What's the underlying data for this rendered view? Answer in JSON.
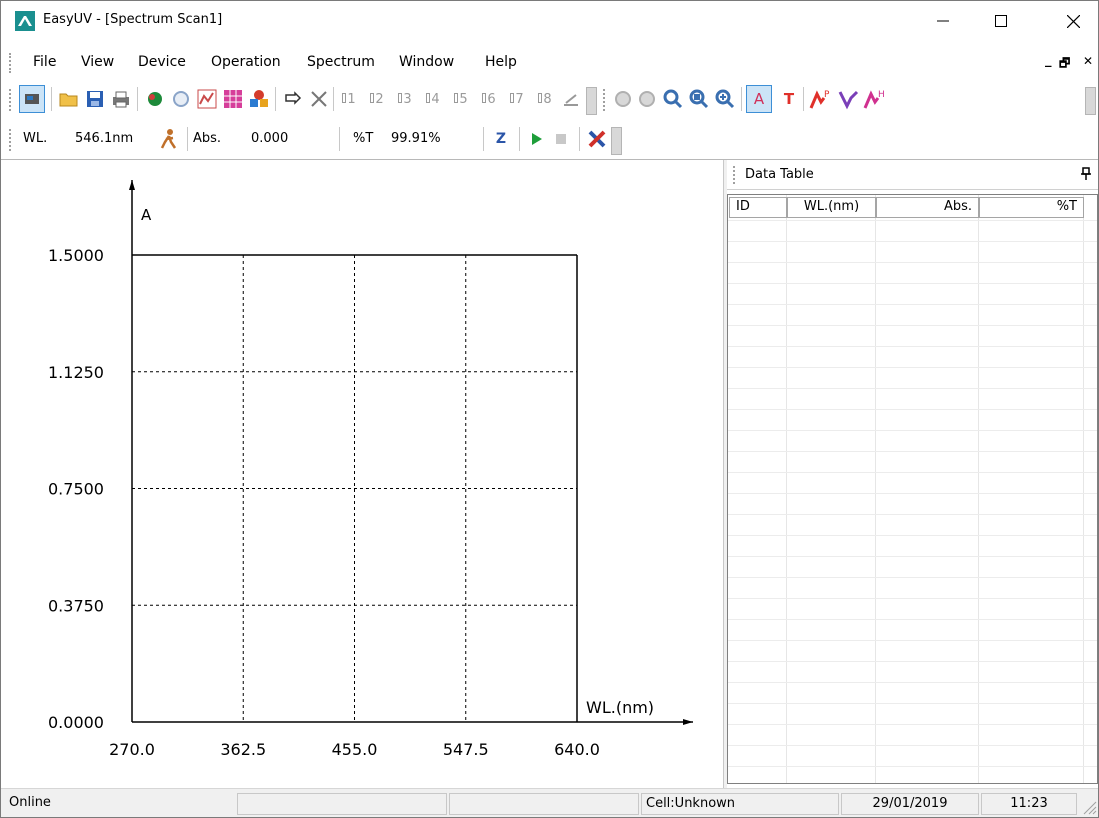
{
  "window": {
    "title": "EasyUV - [Spectrum Scan1]",
    "minimize_glyph": "—",
    "maximize_glyph": "☐",
    "close_glyph": "✕"
  },
  "menu": {
    "items": [
      {
        "label": "File"
      },
      {
        "label": "View"
      },
      {
        "label": "Device"
      },
      {
        "label": "Operation"
      },
      {
        "label": "Spectrum"
      },
      {
        "label": "Window"
      },
      {
        "label": "Help"
      }
    ],
    "mdi_minimize": "_",
    "mdi_restore": "🗗",
    "mdi_close": "✕"
  },
  "toolbar1": {
    "cell_labels": [
      "1",
      "2",
      "3",
      "4",
      "5",
      "6",
      "7",
      "8"
    ]
  },
  "toolbar2": {
    "wl_label": "WL.",
    "wl_value": "546.1nm",
    "abs_label": "Abs.",
    "abs_value": "0.000",
    "t_label": "%T",
    "t_value": "99.91%",
    "zero_label": "Z"
  },
  "chart_data": {
    "type": "line",
    "title": "",
    "xlabel": "WL.(nm)",
    "ylabel": "A",
    "xlim": [
      270.0,
      640.0
    ],
    "ylim": [
      0.0,
      1.5
    ],
    "x_ticks": [
      "270.0",
      "362.5",
      "455.0",
      "547.5",
      "640.0"
    ],
    "y_ticks": [
      "0.0000",
      "0.3750",
      "0.7500",
      "1.1250",
      "1.5000"
    ],
    "grid": true,
    "series": []
  },
  "data_table": {
    "title": "Data Table",
    "pin_glyph": "📌",
    "columns": [
      "ID",
      "WL.(nm)",
      "Abs.",
      "%T"
    ],
    "rows": []
  },
  "status": {
    "connection": "Online",
    "cell": "Cell:Unknown",
    "date": "29/01/2019",
    "time": "11:23"
  }
}
